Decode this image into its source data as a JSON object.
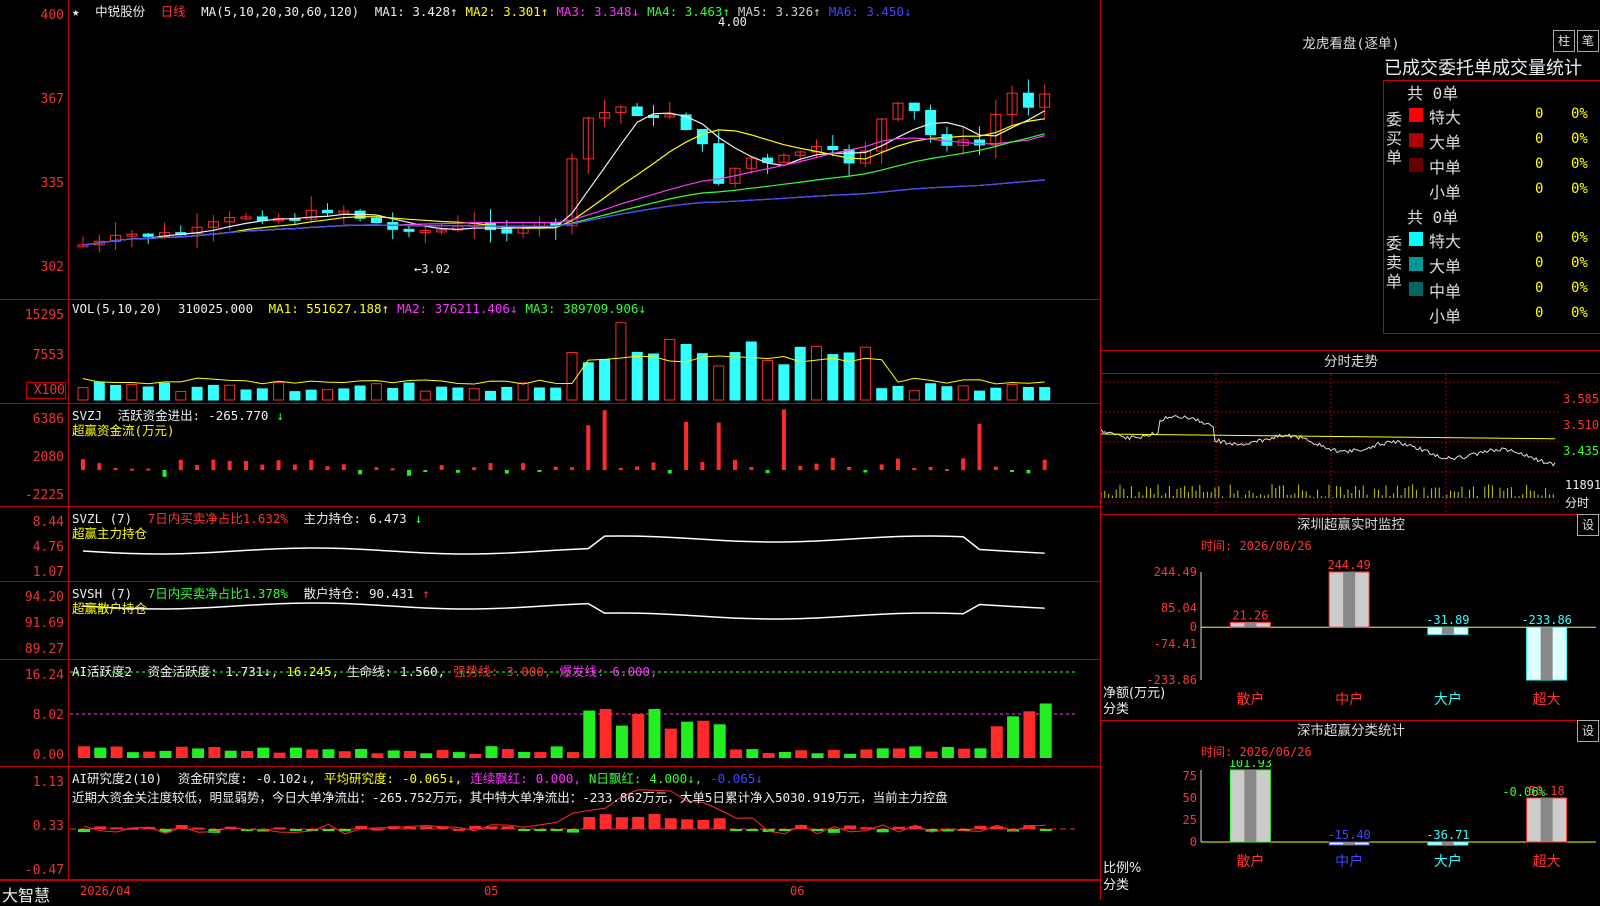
{
  "app": {
    "logo": "大智慧"
  },
  "stock": {
    "star": "★",
    "name": "中锐股份",
    "period": "日线"
  },
  "kline": {
    "ma_title": "MA(5,10,20,30,60,120)",
    "ma": [
      {
        "label": "MA1:",
        "value": "3.428",
        "arrow": "↑",
        "color": "#eeeeee"
      },
      {
        "label": "MA2:",
        "value": "3.301",
        "arrow": "↑",
        "color": "#ffff00"
      },
      {
        "label": "MA3:",
        "value": "3.348",
        "arrow": "↓",
        "color": "#ff33ff"
      },
      {
        "label": "MA4:",
        "value": "3.463",
        "arrow": "↑",
        "color": "#33ff33"
      },
      {
        "label": "MA5:",
        "value": "3.326",
        "arrow": "↑",
        "color": "#cccccc"
      },
      {
        "label": "MA6:",
        "value": "3.450",
        "arrow": "↓",
        "color": "#4444ff"
      }
    ],
    "y_ticks": [
      "400",
      "367",
      "335",
      "302"
    ],
    "high_mark": "4.00",
    "low_mark": "←3.02"
  },
  "vol": {
    "title": "VOL(5,10,20)",
    "value": "310025.000",
    "arrow": "↓",
    "ma": [
      {
        "label": "MA1:",
        "value": "551627.188",
        "arrow": "↑",
        "color": "#ffff00"
      },
      {
        "label": "MA2:",
        "value": "376211.406",
        "arrow": "↓",
        "color": "#ff33ff"
      },
      {
        "label": "MA3:",
        "value": "389709.906",
        "arrow": "↓",
        "color": "#33ff33"
      }
    ],
    "y_ticks": [
      "15295",
      "7553",
      "X100"
    ]
  },
  "svzj": {
    "title": "SVZJ",
    "label": "活跃资金进出:",
    "value": "-265.770",
    "arrow": "↓",
    "sub": "超赢资金流(万元)",
    "y_ticks": [
      "6386",
      "2080",
      "-2225"
    ]
  },
  "svzl": {
    "title": "SVZL (7)",
    "label": "7日内买卖净占比1.632%",
    "label2": "主力持仓:",
    "value": "6.473",
    "arrow": "↓",
    "sub": "超赢主力持仓",
    "y_ticks": [
      "8.44",
      "4.76",
      "1.07"
    ]
  },
  "svsh": {
    "title": "SVSH (7)",
    "label": "7日内买卖净占比1.378%",
    "label2": "散户持仓:",
    "value": "90.431",
    "arrow": "↑",
    "sub": "超赢散户持仓",
    "y_ticks": [
      "94.20",
      "91.69",
      "89.27"
    ]
  },
  "ai1": {
    "title": "AI活跃度2",
    "items": [
      {
        "text": "资金活跃度:",
        "color": "#eeeeee"
      },
      {
        "text": "1.731↓,",
        "color": "#eeeeee"
      },
      {
        "text": "16.245,",
        "color": "#ffff00"
      },
      {
        "text": "生命线:",
        "color": "#eeeeee"
      },
      {
        "text": "1.560,",
        "color": "#eeeeee"
      },
      {
        "text": "强势线:",
        "color": "#ff3333"
      },
      {
        "text": "3.000,",
        "color": "#ff3333"
      },
      {
        "text": "爆发线:",
        "color": "#ff33ff"
      },
      {
        "text": "6.000,",
        "color": "#ff33ff"
      }
    ],
    "y_ticks": [
      "16.24",
      "8.02",
      "0.00"
    ]
  },
  "ai2": {
    "title": "AI研究度2(10)",
    "items": [
      {
        "text": "资金研究度:",
        "color": "#eeeeee"
      },
      {
        "text": "-0.102↓,",
        "color": "#eeeeee"
      },
      {
        "text": "平均研究度:",
        "color": "#ffff00"
      },
      {
        "text": "-0.065↓,",
        "color": "#ffff00"
      },
      {
        "text": "连续飘红:",
        "color": "#ff33ff"
      },
      {
        "text": "0.000,",
        "color": "#ff33ff"
      },
      {
        "text": "N日飘红:",
        "color": "#33ff33"
      },
      {
        "text": "4.000↓,",
        "color": "#33ff33"
      },
      {
        "text": "-0.065↓",
        "color": "#4444ff"
      }
    ],
    "comment": "近期大资金关注度较低，明显弱势，今日大单净流出：-265.752万元，其中特大单净流出：-233.862万元，大单5日累计净入5030.919万元，当前主力控盘",
    "y_ticks": [
      "1.13",
      "0.33",
      "-0.47"
    ]
  },
  "xaxis": {
    "labels": [
      "2026/04",
      "05",
      "06"
    ]
  },
  "panel1": {
    "title": "龙虎看盘(逐单)",
    "btn1": "柱",
    "btn2": "笔",
    "stat_title": "已成交委托单成交量统计",
    "buy": {
      "header": "共 0单",
      "side": "委买单",
      "rows": [
        {
          "label": "特大",
          "val": "0",
          "pct": "0%",
          "color": "#ff0000"
        },
        {
          "label": "大单",
          "val": "0",
          "pct": "0%",
          "color": "#aa0000"
        },
        {
          "label": "中单",
          "val": "0",
          "pct": "0%",
          "color": "#660000"
        },
        {
          "label": "小单",
          "val": "0",
          "pct": "0%",
          "color": ""
        }
      ]
    },
    "sell": {
      "header": "共 0单",
      "side": "委卖单",
      "rows": [
        {
          "label": "特大",
          "val": "0",
          "pct": "0%",
          "color": "#00ffff"
        },
        {
          "label": "大单",
          "val": "0",
          "pct": "0%",
          "color": "#009999"
        },
        {
          "label": "中单",
          "val": "0",
          "pct": "0%",
          "color": "#006666"
        },
        {
          "label": "小单",
          "val": "0",
          "pct": "0%",
          "color": ""
        }
      ]
    }
  },
  "intraday": {
    "title": "分时走势",
    "prices": [
      "3.585",
      "3.510",
      "3.435"
    ],
    "vol": "11891",
    "vol2": "分时"
  },
  "monitor": {
    "title": "深圳超赢实时监控",
    "btn": "设",
    "time": "时间: 2026/06/26",
    "y_ticks": [
      "244.49",
      "85.04",
      "0",
      "-74.41",
      "-233.86"
    ],
    "y_label": "净额(万元)",
    "x_label": "分类",
    "categories": [
      "散户",
      "中户",
      "大户",
      "超大"
    ],
    "values": [
      21.26,
      244.49,
      -31.89,
      -233.86
    ],
    "value_labels": [
      "21.26",
      "244.49",
      "-31.89",
      "-233.86"
    ]
  },
  "classify": {
    "title": "深市超赢分类统计",
    "btn": "设",
    "time": "时间: 2026/06/26",
    "y_ticks": [
      "75",
      "50",
      "25",
      "0"
    ],
    "y_label": "比例%",
    "x_label": "分类",
    "categories": [
      "散户",
      "中户",
      "大户",
      "超大"
    ],
    "values": [
      101.93,
      -15.4,
      -36.71,
      50.18
    ],
    "value_labels": [
      "101.93",
      "-15.40",
      "-36.71",
      "50.18"
    ],
    "extra_label": "-0.06%"
  },
  "chart_data": [
    {
      "type": "bar",
      "title": "深圳超赢实时监控",
      "ylabel": "净额(万元)",
      "xlabel": "分类",
      "categories": [
        "散户",
        "中户",
        "大户",
        "超大"
      ],
      "values": [
        21.26,
        244.49,
        -31.89,
        -233.86
      ],
      "ylim": [
        -233.86,
        244.49
      ]
    },
    {
      "type": "bar",
      "title": "深市超赢分类统计",
      "ylabel": "比例%",
      "xlabel": "分类",
      "categories": [
        "散户",
        "中户",
        "大户",
        "超大"
      ],
      "values": [
        101.93,
        -15.4,
        -36.71,
        50.18
      ],
      "ylim": [
        0,
        75
      ]
    }
  ]
}
